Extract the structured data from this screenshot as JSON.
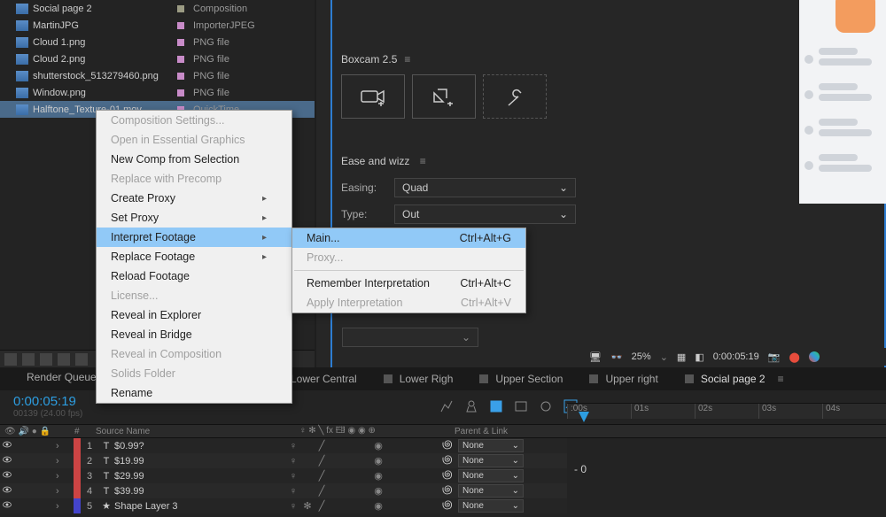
{
  "project": {
    "rows": [
      {
        "name": "Social page 2",
        "type": "Composition",
        "swatch": "#9b9b83"
      },
      {
        "name": "MartinJPG",
        "type": "ImporterJPEG",
        "swatch": "#c88bc8"
      },
      {
        "name": "Cloud 1.png",
        "type": "PNG file",
        "swatch": "#c88bc8"
      },
      {
        "name": "Cloud 2.png",
        "type": "PNG file",
        "swatch": "#c88bc8"
      },
      {
        "name": "shutterstock_513279460.png",
        "type": "PNG file",
        "swatch": "#c88bc8"
      },
      {
        "name": "Window.png",
        "type": "PNG file",
        "swatch": "#c88bc8"
      },
      {
        "name": "Halftone_Texture-01.mov",
        "type": "QuickTime",
        "swatch": "#c88bc8",
        "selected": true
      }
    ]
  },
  "boxcam": {
    "title": "Boxcam 2.5"
  },
  "ease": {
    "title": "Ease and wizz",
    "easing_label": "Easing:",
    "easing_value": "Quad",
    "type_label": "Type:",
    "type_value": "Out"
  },
  "context_menu": {
    "items": [
      {
        "label": "Composition Settings...",
        "disabled": true
      },
      {
        "label": "Open in Essential Graphics",
        "disabled": true
      },
      {
        "label": "New Comp from Selection"
      },
      {
        "label": "Replace with Precomp",
        "disabled": true
      },
      {
        "label": "Create Proxy",
        "submenu": true
      },
      {
        "label": "Set Proxy",
        "submenu": true
      },
      {
        "label": "Interpret Footage",
        "submenu": true,
        "highlighted": true
      },
      {
        "label": "Replace Footage",
        "submenu": true
      },
      {
        "label": "Reload Footage"
      },
      {
        "label": "License...",
        "disabled": true
      },
      {
        "label": "Reveal in Explorer"
      },
      {
        "label": "Reveal in Bridge"
      },
      {
        "label": "Reveal in Composition",
        "disabled": true
      },
      {
        "label": "Solids Folder",
        "disabled": true
      },
      {
        "label": "Rename"
      }
    ]
  },
  "submenu": {
    "items": [
      {
        "label": "Main...",
        "shortcut": "Ctrl+Alt+G",
        "highlighted": true
      },
      {
        "label": "Proxy...",
        "disabled": true
      },
      {
        "sep": true
      },
      {
        "label": "Remember Interpretation",
        "shortcut": "Ctrl+Alt+C"
      },
      {
        "label": "Apply Interpretation",
        "shortcut": "Ctrl+Alt+V",
        "disabled": true
      }
    ]
  },
  "preview_bar": {
    "zoom": "25%",
    "timecode": "0:00:05:19"
  },
  "timeline": {
    "render_queue": "Render Queue",
    "timecode": "0:00:05:19",
    "frames": "00139 (24.00 fps)",
    "tabs": [
      {
        "label": "Lower Central"
      },
      {
        "label": "Lower Righ"
      },
      {
        "label": "Upper Section"
      },
      {
        "label": "Upper right"
      },
      {
        "label": "Social page 2",
        "active": true
      }
    ],
    "ruler": [
      ":00s",
      "01s",
      "02s",
      "03s",
      "04s"
    ],
    "headers": {
      "hash": "#",
      "source": "Source Name",
      "switches": "♀ ✻ ╲ fx 🖽 ◉ ◉ ⊕",
      "parent": "Parent & Link"
    },
    "layers": [
      {
        "num": "1",
        "color": "#c44",
        "ticon": "T",
        "name": "$0.99?",
        "parent": "None"
      },
      {
        "num": "2",
        "color": "#c44",
        "ticon": "T",
        "name": "$19.99",
        "parent": "None"
      },
      {
        "num": "3",
        "color": "#c44",
        "ticon": "T",
        "name": "$29.99",
        "parent": "None"
      },
      {
        "num": "4",
        "color": "#c44",
        "ticon": "T",
        "name": "$39.99",
        "parent": "None"
      },
      {
        "num": "5",
        "color": "#44c",
        "ticon": "★",
        "name": "Shape Layer 3",
        "parent": "None"
      }
    ],
    "marker": "- 0"
  }
}
